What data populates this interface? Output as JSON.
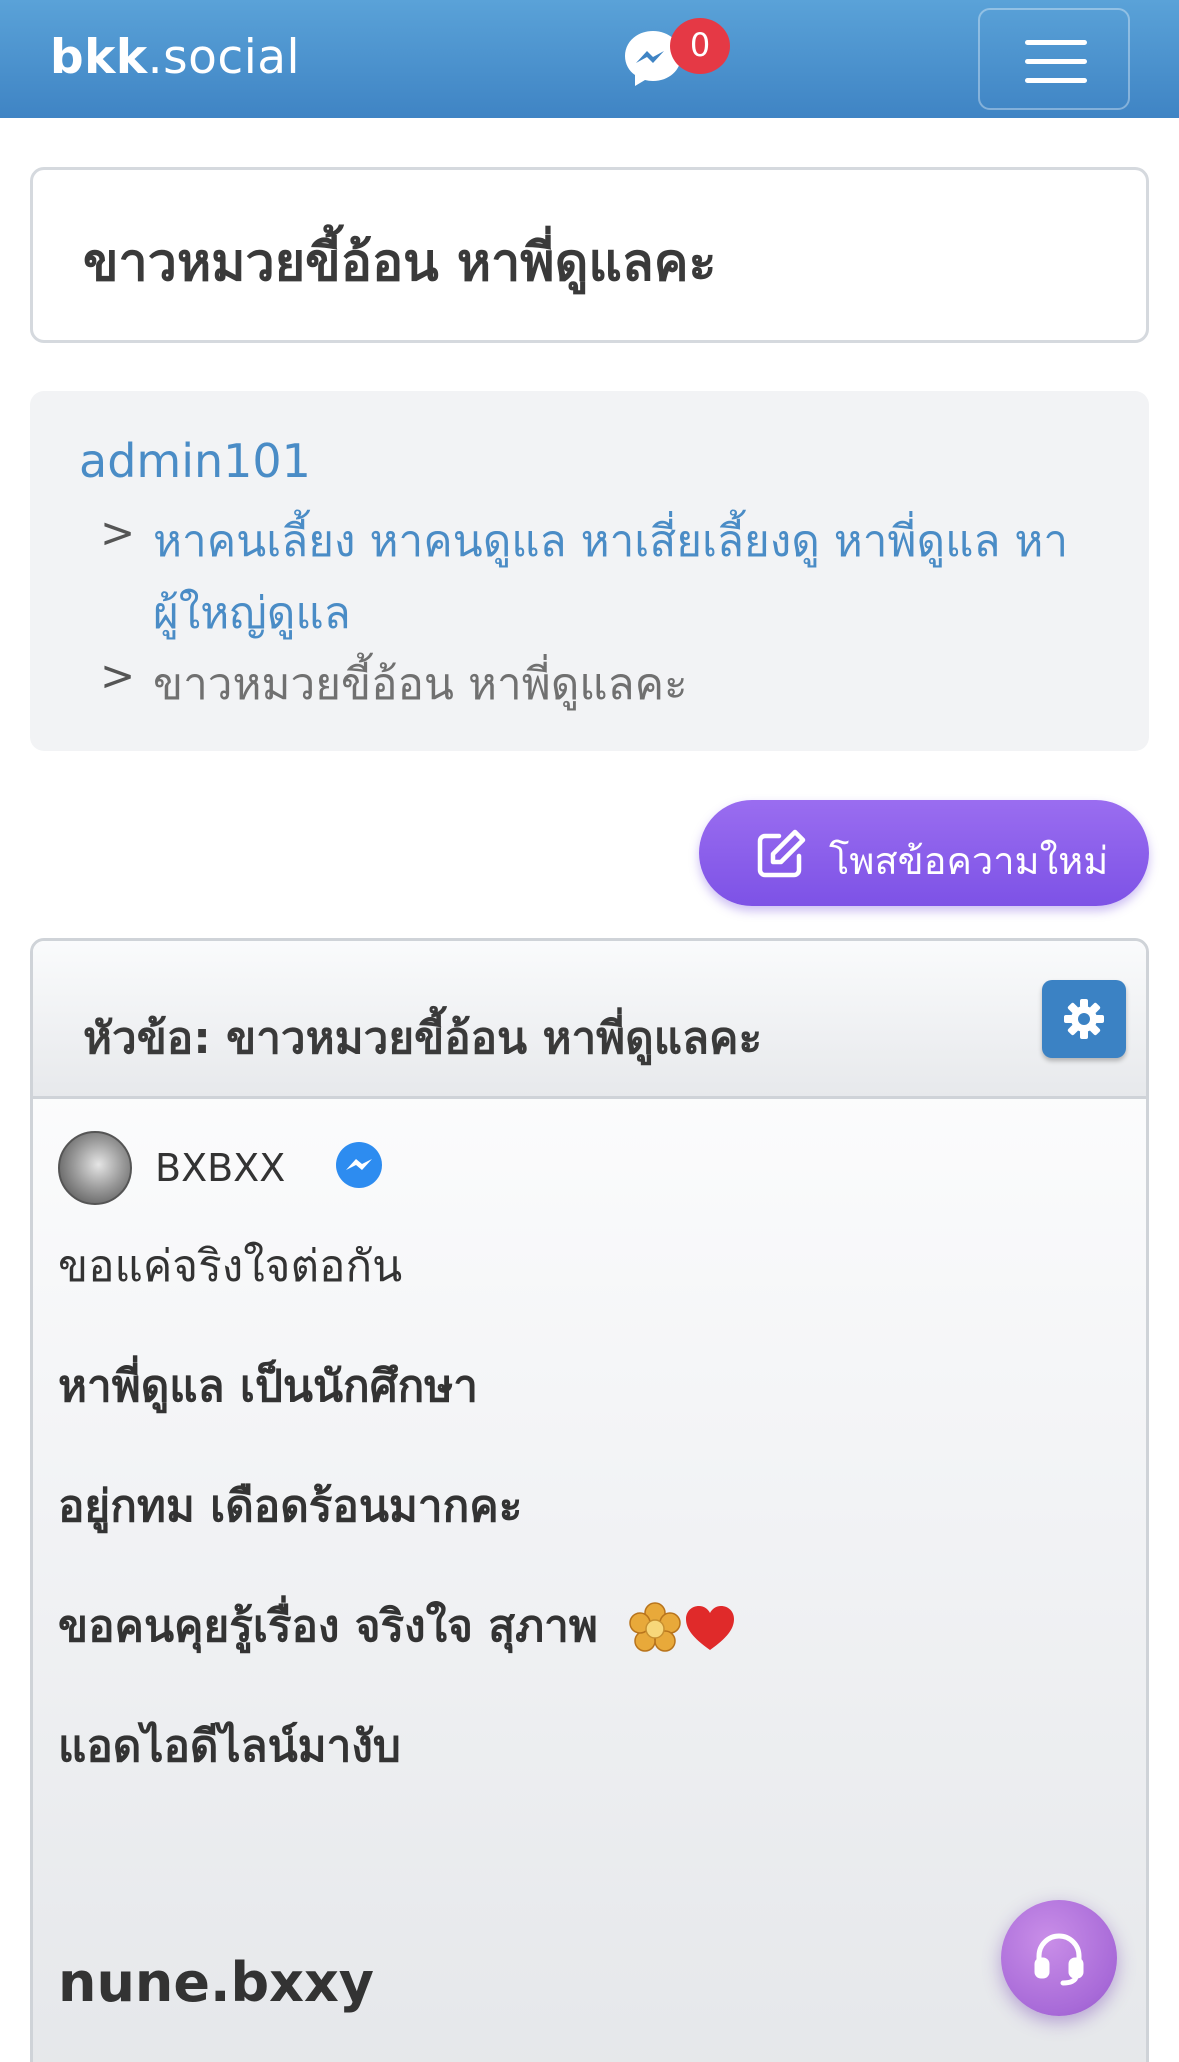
{
  "header": {
    "brand_bold": "bkk",
    "brand_rest": ".social",
    "messenger_count": "0"
  },
  "page": {
    "title": "ขาวหมวยขี้อ้อน หาพี่ดูแลคะ"
  },
  "breadcrumb": {
    "user": "admin101",
    "separator": ">",
    "forum": "หาคนเลี้ยง หาคนดูแล หาเสี่ยเลี้ยงดู หาพี่ดูแล หาผู้ใหญ่ดูแล",
    "current": "ขาวหมวยขี้อ้อน หาพี่ดูแลคะ"
  },
  "actions": {
    "new_post_label": "โพสข้อความใหม่"
  },
  "topic": {
    "heading": "หัวข้อ: ขาวหมวยขี้อ้อน หาพี่ดูแลคะ",
    "author": "BXBXX",
    "lines": [
      "ขอแค่จริงใจต่อกัน",
      "หาพี่ดูแล เป็นนักศึกษา",
      "อยู่กทม เดือดร้อนมากคะ",
      "ขอคนคุยรู้เรื่อง จริงใจ สุภาพ",
      "แอดไอดีไลน์มางับ",
      "nune.bxxy"
    ]
  },
  "colors": {
    "header_bg": "#4a90cf",
    "accent_link": "#4a8cc6",
    "badge_red": "#e53945",
    "button_purple": "#8a5eea"
  }
}
